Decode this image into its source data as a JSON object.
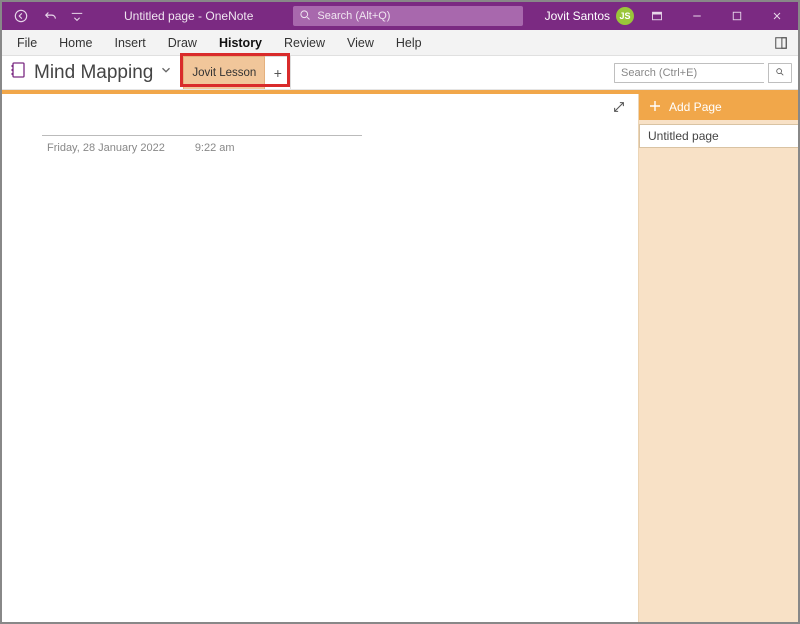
{
  "titlebar": {
    "doc_title": "Untitled page  -  OneNote",
    "search_placeholder": "Search (Alt+Q)",
    "user_name": "Jovit Santos",
    "user_initials": "JS"
  },
  "ribbon": {
    "file": "File",
    "home": "Home",
    "insert": "Insert",
    "draw": "Draw",
    "history": "History",
    "review": "Review",
    "view": "View",
    "help": "Help"
  },
  "notebook": {
    "name": "Mind Mapping",
    "section_tab": "Jovit Lesson",
    "add_tab": "+",
    "page_search_placeholder": "Search (Ctrl+E)"
  },
  "page_panel": {
    "add_page": "Add Page",
    "page1": "Untitled page"
  },
  "canvas": {
    "date": "Friday, 28 January 2022",
    "time": "9:22 am",
    "title": ""
  },
  "colors": {
    "brand": "#7b2a82",
    "accent": "#f1a74a",
    "section_tab": "#f1c69a",
    "highlight": "#d92b2b"
  }
}
